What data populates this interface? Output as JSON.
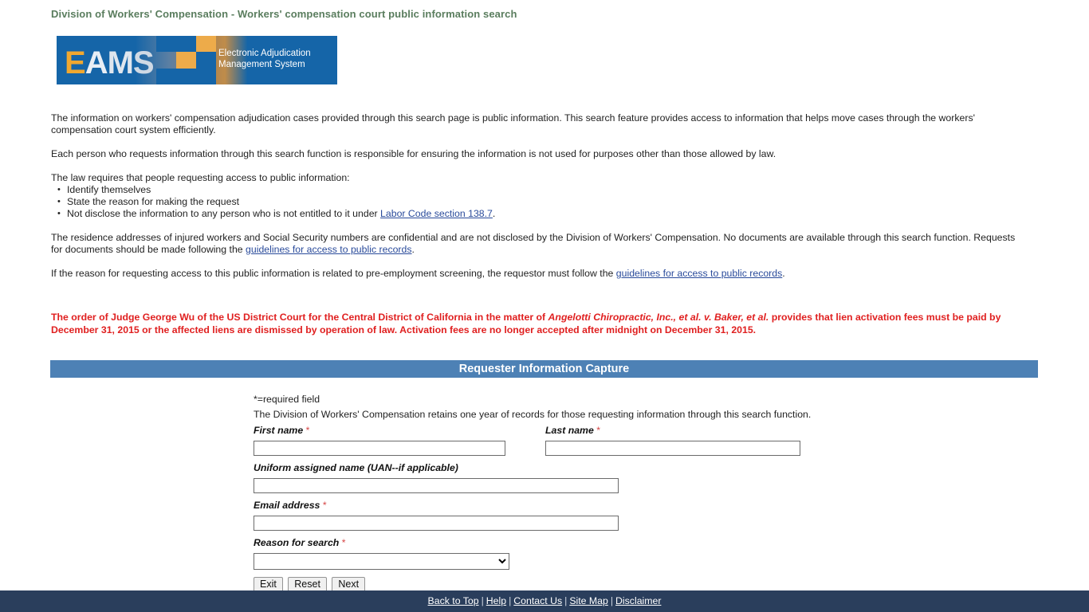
{
  "page": {
    "title": "Division of Workers' Compensation - Workers' compensation court public information search"
  },
  "logo": {
    "wordmark_e": "E",
    "wordmark_a": "A",
    "wordmark_m": "M",
    "wordmark_s": "S",
    "line1": "Electronic Adjudication",
    "line2": "Management System",
    "colors": {
      "blue": "#1565a8",
      "orange": "#edab4a"
    }
  },
  "intro": {
    "paragraph1": "The information on workers' compensation adjudication cases provided through this search page is public information. This search feature provides access to information that helps move cases through the workers' compensation court system efficiently.",
    "paragraph2": "Each person who requests information through this search function is responsible for ensuring the information is not used for purposes other than those allowed by law.",
    "law_intro": "The law requires that people requesting access to public information:",
    "bullets": [
      {
        "text": "Identify themselves"
      },
      {
        "text": "State the reason for making the request"
      },
      {
        "text_before": "Not disclose the information to any person who is not entitled to it under ",
        "link": "Labor Code section 138.7",
        "text_after": "."
      }
    ],
    "paragraph3_before": "The residence addresses of injured workers and Social Security numbers are confidential and are not disclosed by the Division of Workers' Compensation. No documents are available through this search function. Requests for documents should be made following the ",
    "paragraph3_link": "guidelines for access to public records",
    "paragraph3_after": ".",
    "paragraph4_before": "If the reason for requesting access to this public information is related to pre-employment screening, the requestor must follow the ",
    "paragraph4_link": "guidelines for access to public records",
    "paragraph4_after": "."
  },
  "notice": {
    "part1": "The order of Judge George Wu of the US District Court for the Central District of California in the matter of ",
    "italic": "Angelotti Chiropractic, Inc., et al. v. Baker, et al.",
    "part2": " provides that lien activation fees must be paid by December 31, 2015 or the affected liens are dismissed by operation of law. Activation fees are no longer accepted after midnight on December 31, 2015.",
    "color": "#e02020"
  },
  "section": {
    "heading": "Requester Information Capture",
    "bar_color": "#4d81b5"
  },
  "form": {
    "required_note": "*=required field",
    "retention_note": "The Division of Workers' Compensation retains one year of records for those requesting information through this search function.",
    "asterisk": "*",
    "fields": {
      "first_name": {
        "label": "First name",
        "value": "",
        "required": true
      },
      "last_name": {
        "label": "Last name",
        "value": "",
        "required": true
      },
      "uan": {
        "label": "Uniform assigned name (UAN--if applicable)",
        "value": "",
        "required": false
      },
      "email": {
        "label": "Email address",
        "value": "",
        "required": true
      },
      "reason": {
        "label": "Reason for search",
        "value": "",
        "required": true,
        "options": [
          ""
        ]
      }
    },
    "buttons": {
      "exit": "Exit",
      "reset": "Reset",
      "next": "Next"
    }
  },
  "footer": {
    "links": [
      {
        "label": "Back to Top"
      },
      {
        "label": "Help"
      },
      {
        "label": "Contact Us"
      },
      {
        "label": "Site Map"
      },
      {
        "label": "Disclaimer"
      }
    ],
    "separator": "|",
    "background": "#2a3e5c"
  }
}
